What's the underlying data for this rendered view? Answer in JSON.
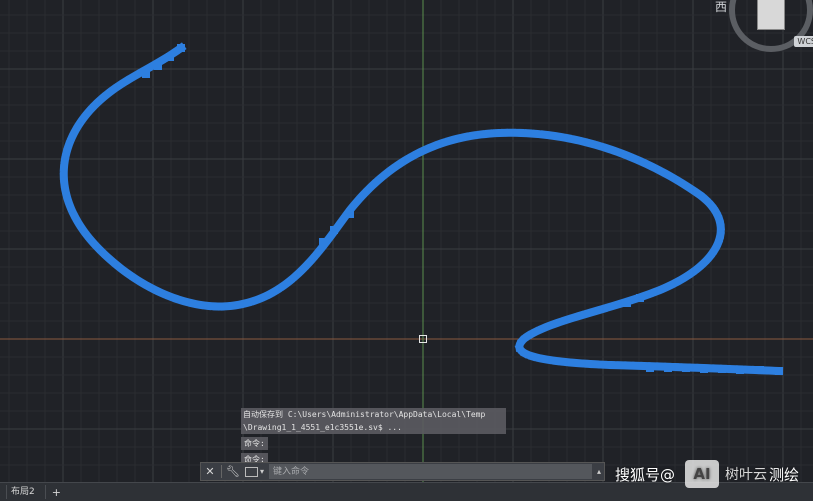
{
  "colors": {
    "background": "#202227",
    "grid_major": "#3a3d42",
    "grid_minor": "#2a2c31",
    "axis_y": "#5a8f4c",
    "axis_x": "#8a5a3f",
    "spline": "#2d7fe0"
  },
  "viewcube": {
    "compass_label": "西",
    "wcs_label": "WCS"
  },
  "command_history": {
    "lines": [
      "自动保存到 C:\\Users\\Administrator\\AppData\\Local\\Temp",
      "\\Drawing1_1_4551_e1c3551e.sv$ ..."
    ],
    "prompts": [
      "命令:",
      "命令:"
    ]
  },
  "command_line": {
    "close_icon": "close-icon",
    "customize_icon": "wrench-icon",
    "recent_icon": "recent-commands-icon",
    "placeholder": "键入命令"
  },
  "tabs": {
    "items": [
      "",
      "布局2"
    ],
    "add_label": "+"
  },
  "watermark": {
    "brand1": "搜狐号@",
    "logo_text": "AI",
    "brand2": "树叶云",
    "suffix": "测绘"
  }
}
